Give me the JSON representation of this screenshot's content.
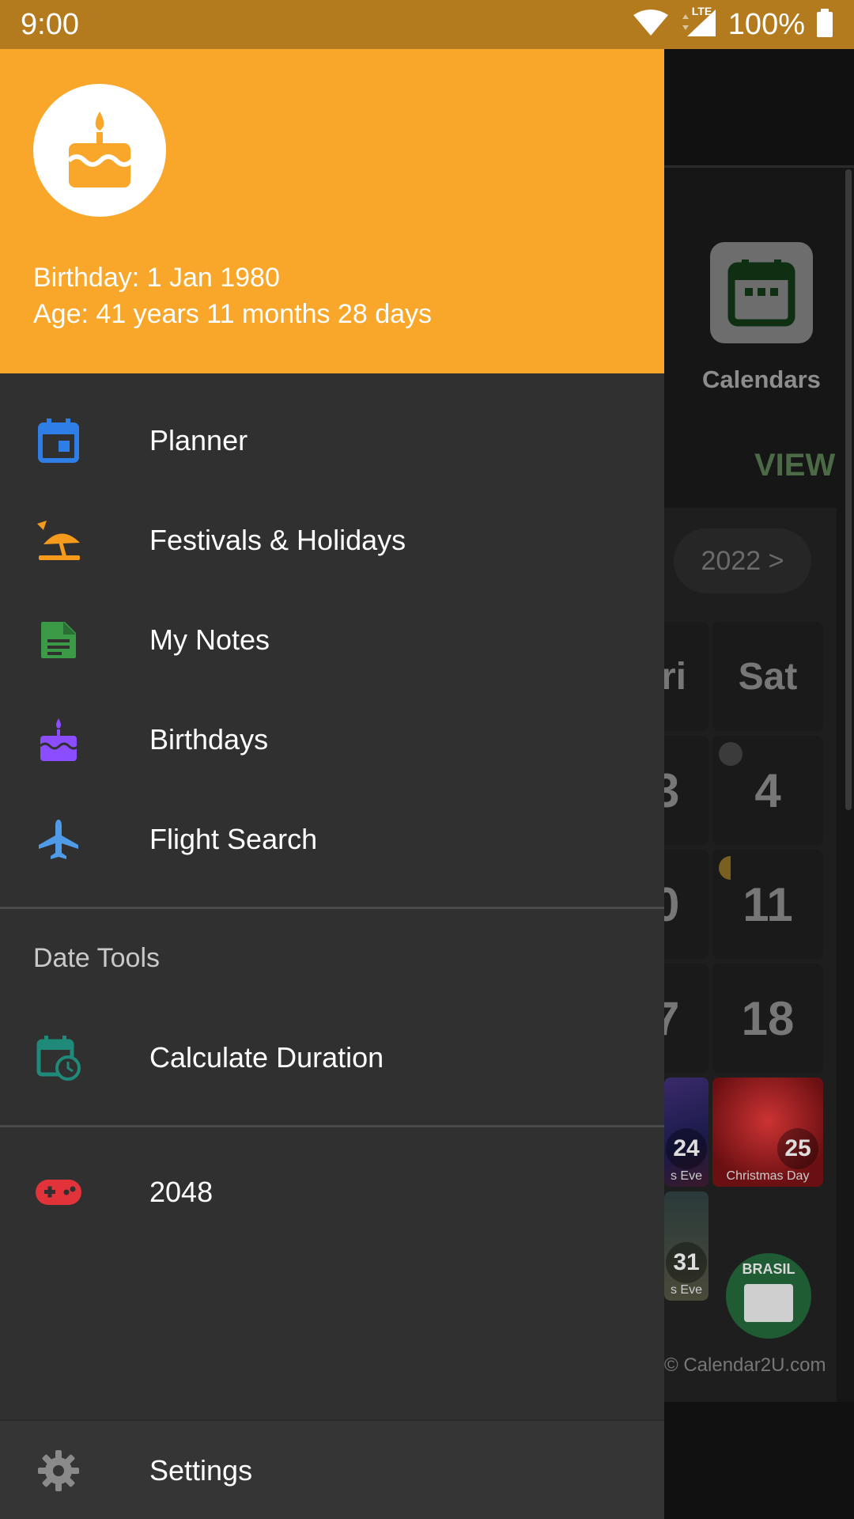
{
  "status_bar": {
    "time": "9:00",
    "battery": "100%",
    "network": "LTE",
    "icons": [
      "wifi-icon",
      "signal-icon",
      "battery-icon"
    ]
  },
  "drawer": {
    "header": {
      "avatar_icon": "cake-icon",
      "birthday": "Birthday: 1 Jan 1980",
      "age": "Age: 41 years 11 months 28 days",
      "color": "#f8a72a"
    },
    "items": [
      {
        "label": "Planner",
        "icon": "calendar-icon",
        "color": "#2f7ee8"
      },
      {
        "label": "Festivals & Holidays",
        "icon": "beach-umbrella-icon",
        "color": "#f59a1b"
      },
      {
        "label": "My Notes",
        "icon": "note-icon",
        "color": "#3a9a45"
      },
      {
        "label": "Birthdays",
        "icon": "cake-icon",
        "color": "#8a4dff"
      },
      {
        "label": "Flight Search",
        "icon": "airplane-icon",
        "color": "#4f9be8"
      }
    ],
    "section_date_tools": "Date Tools",
    "date_tools": [
      {
        "label": "Calculate Duration",
        "icon": "calendar-clock-icon",
        "color": "#1f8a7a"
      }
    ],
    "games": [
      {
        "label": "2048",
        "icon": "gamepad-icon",
        "color": "#e2333b"
      }
    ],
    "settings": {
      "label": "Settings",
      "icon": "gear-icon",
      "color": "#8a8a8a"
    }
  },
  "background": {
    "calendars_label": "Calendars",
    "view_label": "VIEW",
    "year_button": "2022 >",
    "day_headers": [
      "ri",
      "Sat"
    ],
    "rows": [
      [
        "3",
        "4"
      ],
      [
        "0",
        "11"
      ],
      [
        "7",
        "18"
      ]
    ],
    "holiday_cells": [
      {
        "num": "24",
        "caption": "s Eve"
      },
      {
        "num": "25",
        "caption": "Christmas Day"
      },
      {
        "num": "31",
        "caption": "s Eve"
      }
    ],
    "brasil_label": "BRASIL",
    "copyright": "© Calendar2U.com"
  }
}
